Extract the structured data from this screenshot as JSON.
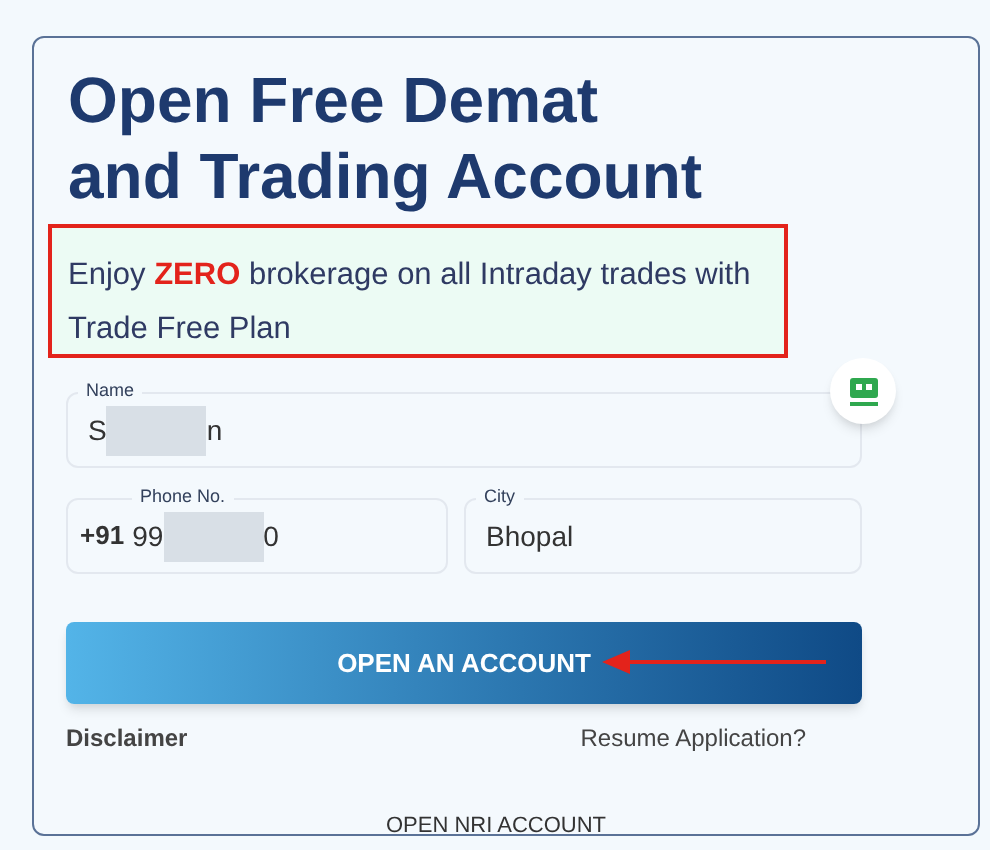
{
  "title": [
    "Open Free Demat",
    "and Trading Account"
  ],
  "promo": {
    "text": "Enjoy **ZERO** brokerage on all Intraday trades with Trade Free Plan",
    "highlighted": true
  },
  "fields": [
    {
      "label": "Name",
      "value_start": "S",
      "value_end": "n",
      "redacted": true
    },
    {
      "label": "Phone No.",
      "prefix": "+91",
      "value_start": "99",
      "value_end": "0",
      "redacted": true
    },
    {
      "label": "City",
      "value_start": "Bhopal",
      "redacted": false
    }
  ],
  "submit_button": {
    "label": "OPEN AN ACCOUNT",
    "annotated": true
  },
  "links": {
    "disclaimer": "Disclaimer",
    "resume": "Resume Application?"
  },
  "nri_link": "OPEN NRI ACCOUNT"
}
